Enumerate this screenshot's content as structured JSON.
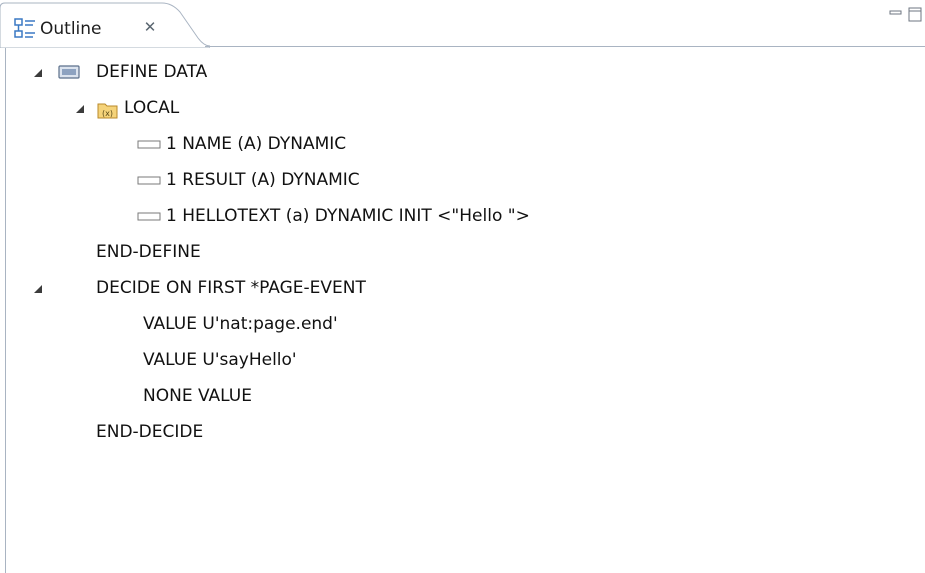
{
  "tab": {
    "title": "Outline",
    "close_glyph": "✕",
    "icon": "outline-icon"
  },
  "window_buttons": {
    "minimize_icon": "minimize-icon",
    "maximize_icon": "maximize-icon"
  },
  "tree": {
    "define_data": "DEFINE DATA",
    "local": "LOCAL",
    "field_name": "1 NAME (A) DYNAMIC",
    "field_result": "1 RESULT (A) DYNAMIC",
    "field_hellotext": "1 HELLOTEXT (a) DYNAMIC INIT <\"Hello \">",
    "end_define": "END-DEFINE",
    "decide": "DECIDE ON FIRST *PAGE-EVENT",
    "value_page_end": "VALUE U'nat:page.end'",
    "value_say_hello": "VALUE U'sayHello'",
    "none_value": "NONE VALUE",
    "end_decide": "END-DECIDE"
  },
  "colors": {
    "border": "#a9b4c2",
    "toggle": "#3c3c3c",
    "folder": "#e8b84a"
  }
}
